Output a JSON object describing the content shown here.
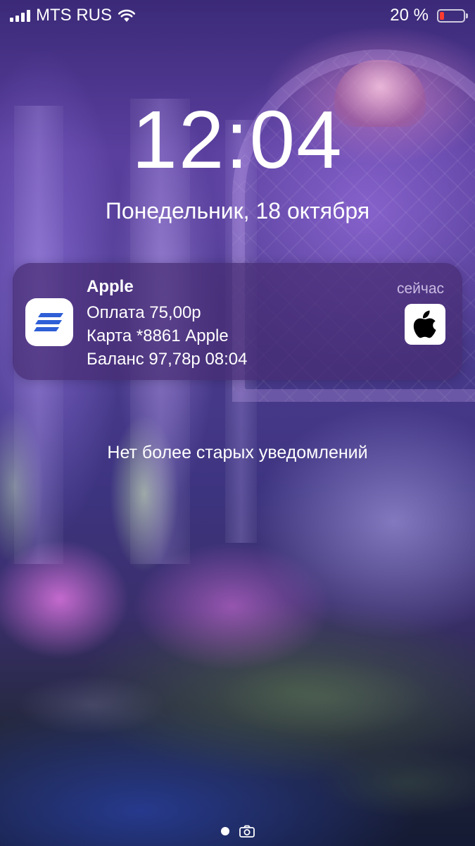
{
  "status_bar": {
    "carrier": "MTS RUS",
    "battery_percent_text": "20 %",
    "battery_level": 0.2,
    "battery_fill_color": "#ff3b30",
    "signal_icon": "signal-bars-icon",
    "wifi_icon": "wifi-icon"
  },
  "lock_screen": {
    "time": "12:04",
    "date": "Понедельник, 18 октября"
  },
  "notification": {
    "app_name": "Apple",
    "timestamp": "сейчас",
    "lines": [
      "Оплата 75,00р",
      "Карта *8861 Apple",
      "Баланс 97,78р 08:04"
    ],
    "app_icon": "bank-app-icon",
    "app_icon_color": "#2f5fd6",
    "attachment_icon": "apple-logo-icon"
  },
  "footer_message": "Нет более старых уведомлений",
  "page_indicator": {
    "dot_icon": "page-dot-icon",
    "camera_icon": "camera-icon"
  }
}
